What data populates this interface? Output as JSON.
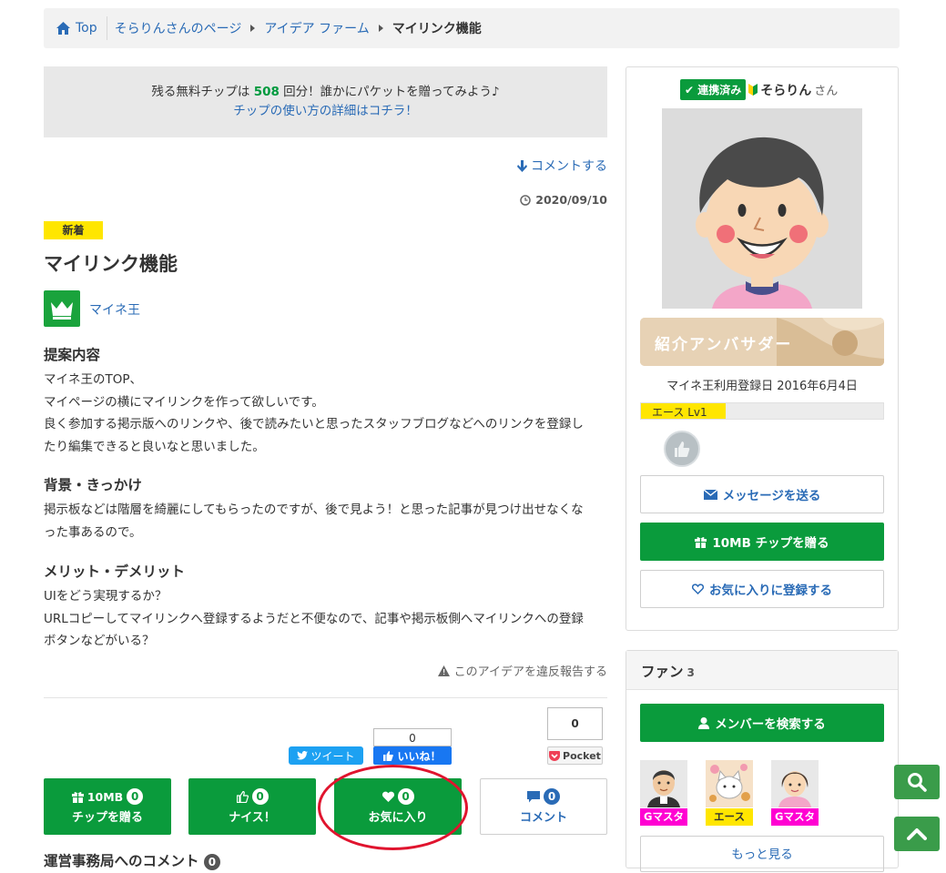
{
  "breadcrumb": {
    "home": "Top",
    "items": [
      "そらりんさんのページ",
      "アイデア ファーム"
    ],
    "current": "マイリンク機能"
  },
  "notice": {
    "prefix": "残る無料チップは ",
    "count": "508",
    "suffix": " 回分！誰かにパケットを贈ってみよう♪",
    "link": "チップの使い方の詳細はコチラ！"
  },
  "post": {
    "comment_link": "コメントする",
    "date": "2020/09/10",
    "badge": "新着",
    "title": "マイリンク機能",
    "category": "マイネ王",
    "sections": [
      {
        "heading": "提案内容",
        "lines": [
          "マイネ王のTOP、",
          "マイページの横にマイリンクを作って欲しいです。",
          "良く参加する掲示版へのリンクや、後で読みたいと思ったスタッフブログなどへのリンクを登録し",
          "たり編集できると良いなと思いました。"
        ]
      },
      {
        "heading": "背景・きっかけ",
        "lines": [
          "掲示板などは階層を綺麗にしてもらったのですが、後で見よう！と思った記事が見つけ出せなくな",
          "った事あるので。"
        ]
      },
      {
        "heading": "メリット・デメリット",
        "lines": [
          "UIをどう実現するか？",
          "URLコピーしてマイリンクへ登録するようだと不便なので、記事や掲示板側へマイリンクへの登録",
          "ボタンなどがいる？"
        ]
      }
    ],
    "report": "このアイデアを違反報告する"
  },
  "social": {
    "tweet": "ツイート",
    "fb_count": "0",
    "fb_like": "いいね！",
    "pocket_count": "0",
    "pocket": "Pocket"
  },
  "actions": [
    {
      "top": "10MB",
      "count": "0",
      "label": "チップを贈る",
      "icon": "gift-icon"
    },
    {
      "top": "",
      "count": "0",
      "label": "ナイス！",
      "icon": "thumbs-up-icon"
    },
    {
      "top": "",
      "count": "0",
      "label": "お気に入り",
      "icon": "heart-icon"
    },
    {
      "top": "",
      "count": "0",
      "label": "コメント",
      "icon": "comment-icon"
    }
  ],
  "admin_comment": {
    "title": "運営事務局へのコメント",
    "count": "0"
  },
  "sidebar": {
    "linked_badge": "連携済み",
    "user_name": "そらりん",
    "san": "さん",
    "ambassador": "紹介アンバサダー",
    "reg_date": "マイネ王利用登録日 2016年6月4日",
    "rank_label": "エース Lv1",
    "rank_progress": 0.35,
    "buttons": {
      "message": "メッセージを送る",
      "tip": "10MB チップを贈る",
      "favorite": "お気に入りに登録する"
    }
  },
  "fans": {
    "title": "ファン",
    "count": "3",
    "search": "メンバーを検索する",
    "members": [
      {
        "tag": "Gマスタ"
      },
      {
        "tag": "エース"
      },
      {
        "tag": "Gマスタ"
      }
    ],
    "more": "もっと見る"
  },
  "colors": {
    "green": "#0a9b3c",
    "link": "#2a6bb6",
    "badge_yellow": "#ffe600",
    "tag_magenta": "#ff00d2",
    "highlight_red": "#e0142e"
  }
}
